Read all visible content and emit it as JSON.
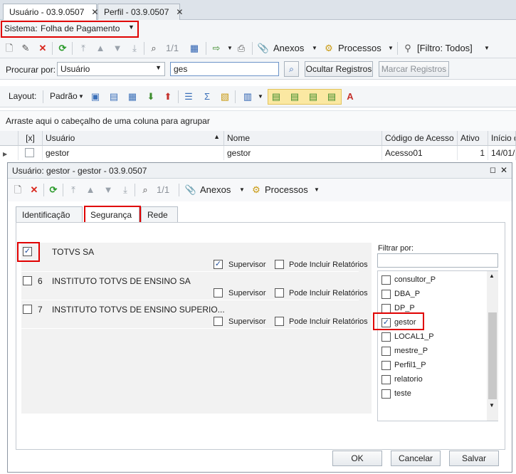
{
  "doc_tabs": [
    {
      "label": "Usuário - 03.9.0507",
      "active": true,
      "close": "✕"
    },
    {
      "label": "Perfil - 03.9.0507",
      "active": false,
      "close": "✕"
    }
  ],
  "system_selector": {
    "label": "Sistema:",
    "value": "Folha de Pagamento"
  },
  "main_toolbar": {
    "record_counter": "1/1",
    "anexos_label": "Anexos",
    "processos_label": "Processos",
    "filter_label": "[Filtro: Todos]"
  },
  "search": {
    "label": "Procurar por:",
    "field_value": "Usuário",
    "query": "ges",
    "hide_button": "Ocultar Registros",
    "mark_button": "Marcar Registros"
  },
  "layout_bar": {
    "layout_label": "Layout:",
    "layout_value": "Padrão"
  },
  "group_hint": "Arraste aqui o cabeçalho de uma coluna para agrupar",
  "grid": {
    "columns": [
      "[x]",
      "Usuário",
      "Nome",
      "Código de Acesso",
      "Ativo",
      "Início d"
    ],
    "rows": [
      {
        "usuario": "gestor",
        "nome": "gestor",
        "codigo": "Acesso01",
        "ativo": "1",
        "inicio": "14/01/2"
      }
    ]
  },
  "dialog": {
    "title": "Usuário: gestor - gestor - 03.9.0507",
    "record_counter": "1/1",
    "anexos_label": "Anexos",
    "processos_label": "Processos",
    "tabs": [
      "Identificação",
      "Segurança",
      "Rede"
    ],
    "active_tab": "Segurança",
    "companies": [
      {
        "code": "",
        "name": "TOTVS SA",
        "checked": true,
        "supervisor": true,
        "relatorios": false
      },
      {
        "code": "6",
        "name": "INSTITUTO TOTVS DE ENSINO SA",
        "checked": false,
        "supervisor": false,
        "relatorios": false
      },
      {
        "code": "7",
        "name": "INSTITUTO TOTVS DE ENSINO SUPERIO...",
        "checked": false,
        "supervisor": false,
        "relatorios": false
      }
    ],
    "supervisor_label": "Supervisor",
    "relatorios_label": "Pode Incluir Relatórios",
    "filter_label": "Filtrar por:",
    "filter_value": "",
    "profiles": [
      {
        "name": "consultor_P",
        "checked": false
      },
      {
        "name": "DBA_P",
        "checked": false
      },
      {
        "name": "DP_P",
        "checked": false
      },
      {
        "name": "gestor",
        "checked": true
      },
      {
        "name": "LOCAL1_P",
        "checked": false
      },
      {
        "name": "mestre_P",
        "checked": false
      },
      {
        "name": "Perfil1_P",
        "checked": false
      },
      {
        "name": "relatorio",
        "checked": false
      },
      {
        "name": "teste",
        "checked": false
      }
    ],
    "buttons": {
      "ok": "OK",
      "cancel": "Cancelar",
      "save": "Salvar"
    }
  },
  "colors": {
    "highlight_red": "#e00000",
    "toolbar_bg": "#f4f6f8",
    "accent_blue": "#1f4e9a"
  }
}
